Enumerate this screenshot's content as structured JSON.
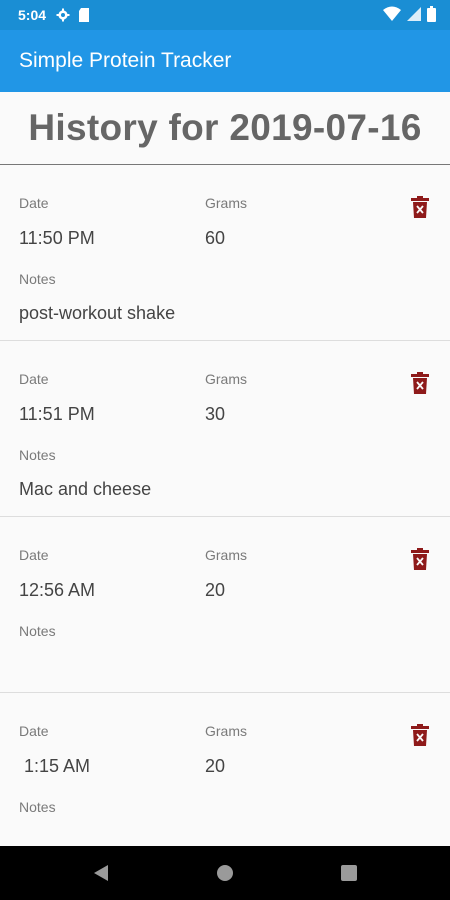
{
  "status_bar": {
    "time": "5:04",
    "icons": [
      "gear-icon",
      "sd-card-icon",
      "wifi-icon",
      "signal-icon",
      "battery-icon"
    ]
  },
  "app_bar": {
    "title": "Simple Protein Tracker",
    "color": "#2196e6"
  },
  "page": {
    "title": "History for 2019-07-16"
  },
  "labels": {
    "date": "Date",
    "grams": "Grams",
    "notes": "Notes"
  },
  "entries": [
    {
      "date": "11:50 PM",
      "grams": "60",
      "notes": "post-workout shake"
    },
    {
      "date": "11:51 PM",
      "grams": "30",
      "notes": "Mac and cheese"
    },
    {
      "date": "12:56 AM",
      "grams": "20",
      "notes": ""
    },
    {
      "date": " 1:15 AM",
      "grams": "20",
      "notes": ""
    }
  ],
  "colors": {
    "delete_icon": "#8e1a1a",
    "status_bar": "#1a8ed4"
  },
  "nav": {
    "icons": [
      "back-icon",
      "home-icon",
      "recents-icon"
    ]
  }
}
